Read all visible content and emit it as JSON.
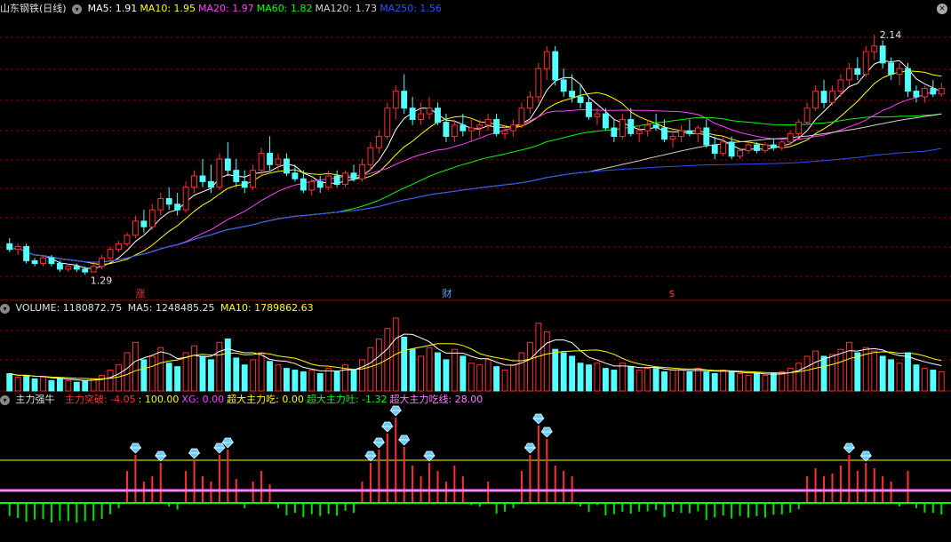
{
  "header": {
    "title": "山东钢铁(日线)",
    "ma": [
      {
        "label": "MA5: 1.91",
        "color": "#ffffff"
      },
      {
        "label": "MA10: 1.95",
        "color": "#ffff00"
      },
      {
        "label": "MA20: 1.97",
        "color": "#ff40ff"
      },
      {
        "label": "MA60: 1.82",
        "color": "#00ff00"
      },
      {
        "label": "MA120: 1.73",
        "color": "#d0d0d0"
      },
      {
        "label": "MA250: 1.56",
        "color": "#3050ff"
      }
    ]
  },
  "price_annotations": {
    "high": "2.14",
    "low": "1.29"
  },
  "event_markers": [
    {
      "text": "涨",
      "color": "#ff3030"
    },
    {
      "text": "财",
      "color": "#60a0ff"
    },
    {
      "text": "$",
      "color": "#ff3030"
    }
  ],
  "volume_header": {
    "title": "VOLUME: 1180872.75",
    "ma5": "MA5: 1248485.25",
    "ma10": "MA10: 1789862.63"
  },
  "indicator_header": {
    "title": "主力强牛",
    "items": [
      {
        "label": "主力突破: -4.05",
        "color": "#ff3030"
      },
      {
        "label": ": 100.00",
        "color": "#ffff00"
      },
      {
        "label": "XG: 0.00",
        "color": "#ff40ff"
      },
      {
        "label": "超大主力吃: 0.00",
        "color": "#ffff00"
      },
      {
        "label": "超大主力吐: -1.32",
        "color": "#00ff00"
      },
      {
        "label": "超大主力吃线: 28.00",
        "color": "#ff80ff"
      }
    ]
  },
  "colors": {
    "up": "#ff3030",
    "down": "#54ffff",
    "grid": "#8b0000",
    "ma5": "#ffffff",
    "ma10": "#ffff00",
    "ma20": "#ff40ff",
    "ma60": "#00ff00",
    "ma120": "#d0d0d0",
    "ma250": "#3050ff"
  },
  "chart_data": {
    "type": "candlestick",
    "price_range": [
      1.25,
      2.2
    ],
    "high_label": 2.14,
    "low_label": 1.29,
    "candles_ohlc": [
      [
        1.4,
        1.42,
        1.37,
        1.38
      ],
      [
        1.38,
        1.4,
        1.36,
        1.39
      ],
      [
        1.39,
        1.4,
        1.33,
        1.34
      ],
      [
        1.34,
        1.35,
        1.32,
        1.33
      ],
      [
        1.33,
        1.36,
        1.32,
        1.35
      ],
      [
        1.35,
        1.36,
        1.32,
        1.33
      ],
      [
        1.33,
        1.34,
        1.3,
        1.31
      ],
      [
        1.31,
        1.33,
        1.3,
        1.32
      ],
      [
        1.32,
        1.33,
        1.3,
        1.31
      ],
      [
        1.31,
        1.32,
        1.29,
        1.3
      ],
      [
        1.3,
        1.33,
        1.3,
        1.32
      ],
      [
        1.32,
        1.36,
        1.31,
        1.35
      ],
      [
        1.35,
        1.39,
        1.34,
        1.38
      ],
      [
        1.38,
        1.41,
        1.37,
        1.4
      ],
      [
        1.4,
        1.44,
        1.39,
        1.43
      ],
      [
        1.43,
        1.5,
        1.42,
        1.48
      ],
      [
        1.48,
        1.52,
        1.44,
        1.46
      ],
      [
        1.46,
        1.54,
        1.45,
        1.52
      ],
      [
        1.52,
        1.58,
        1.5,
        1.56
      ],
      [
        1.56,
        1.6,
        1.52,
        1.54
      ],
      [
        1.54,
        1.58,
        1.5,
        1.52
      ],
      [
        1.52,
        1.62,
        1.51,
        1.6
      ],
      [
        1.6,
        1.66,
        1.58,
        1.64
      ],
      [
        1.64,
        1.7,
        1.6,
        1.62
      ],
      [
        1.62,
        1.68,
        1.58,
        1.6
      ],
      [
        1.6,
        1.72,
        1.59,
        1.7
      ],
      [
        1.7,
        1.76,
        1.64,
        1.66
      ],
      [
        1.66,
        1.7,
        1.6,
        1.62
      ],
      [
        1.62,
        1.66,
        1.58,
        1.6
      ],
      [
        1.6,
        1.68,
        1.59,
        1.66
      ],
      [
        1.66,
        1.74,
        1.64,
        1.72
      ],
      [
        1.72,
        1.78,
        1.66,
        1.68
      ],
      [
        1.68,
        1.72,
        1.66,
        1.7
      ],
      [
        1.7,
        1.72,
        1.64,
        1.65
      ],
      [
        1.65,
        1.68,
        1.62,
        1.63
      ],
      [
        1.63,
        1.66,
        1.58,
        1.59
      ],
      [
        1.59,
        1.63,
        1.57,
        1.62
      ],
      [
        1.62,
        1.64,
        1.58,
        1.6
      ],
      [
        1.6,
        1.66,
        1.59,
        1.64
      ],
      [
        1.64,
        1.66,
        1.6,
        1.61
      ],
      [
        1.61,
        1.66,
        1.6,
        1.65
      ],
      [
        1.65,
        1.68,
        1.62,
        1.63
      ],
      [
        1.63,
        1.7,
        1.62,
        1.68
      ],
      [
        1.68,
        1.76,
        1.66,
        1.74
      ],
      [
        1.74,
        1.8,
        1.72,
        1.78
      ],
      [
        1.78,
        1.9,
        1.77,
        1.88
      ],
      [
        1.88,
        1.96,
        1.84,
        1.94
      ],
      [
        1.94,
        2.0,
        1.86,
        1.88
      ],
      [
        1.88,
        1.92,
        1.82,
        1.84
      ],
      [
        1.84,
        1.9,
        1.82,
        1.86
      ],
      [
        1.86,
        1.92,
        1.84,
        1.88
      ],
      [
        1.88,
        1.9,
        1.82,
        1.83
      ],
      [
        1.83,
        1.86,
        1.76,
        1.78
      ],
      [
        1.78,
        1.84,
        1.76,
        1.82
      ],
      [
        1.82,
        1.86,
        1.78,
        1.8
      ],
      [
        1.8,
        1.84,
        1.76,
        1.81
      ],
      [
        1.81,
        1.84,
        1.78,
        1.82
      ],
      [
        1.82,
        1.86,
        1.8,
        1.84
      ],
      [
        1.84,
        1.86,
        1.78,
        1.79
      ],
      [
        1.79,
        1.82,
        1.77,
        1.8
      ],
      [
        1.8,
        1.84,
        1.78,
        1.82
      ],
      [
        1.82,
        1.9,
        1.81,
        1.88
      ],
      [
        1.88,
        1.94,
        1.86,
        1.92
      ],
      [
        1.92,
        2.04,
        1.9,
        2.02
      ],
      [
        2.02,
        2.1,
        1.98,
        2.08
      ],
      [
        2.08,
        2.1,
        1.96,
        1.98
      ],
      [
        1.98,
        2.02,
        1.92,
        1.94
      ],
      [
        1.94,
        2.0,
        1.9,
        1.92
      ],
      [
        1.92,
        1.96,
        1.88,
        1.9
      ],
      [
        1.9,
        1.92,
        1.84,
        1.85
      ],
      [
        1.85,
        1.88,
        1.82,
        1.86
      ],
      [
        1.86,
        1.88,
        1.8,
        1.81
      ],
      [
        1.81,
        1.84,
        1.76,
        1.78
      ],
      [
        1.78,
        1.86,
        1.77,
        1.84
      ],
      [
        1.84,
        1.88,
        1.78,
        1.79
      ],
      [
        1.79,
        1.82,
        1.76,
        1.8
      ],
      [
        1.8,
        1.84,
        1.78,
        1.82
      ],
      [
        1.82,
        1.86,
        1.8,
        1.81
      ],
      [
        1.81,
        1.84,
        1.76,
        1.77
      ],
      [
        1.77,
        1.8,
        1.74,
        1.78
      ],
      [
        1.78,
        1.82,
        1.76,
        1.8
      ],
      [
        1.8,
        1.84,
        1.78,
        1.79
      ],
      [
        1.79,
        1.82,
        1.76,
        1.81
      ],
      [
        1.81,
        1.84,
        1.74,
        1.75
      ],
      [
        1.75,
        1.78,
        1.7,
        1.72
      ],
      [
        1.72,
        1.78,
        1.71,
        1.76
      ],
      [
        1.76,
        1.78,
        1.7,
        1.71
      ],
      [
        1.71,
        1.74,
        1.7,
        1.73
      ],
      [
        1.73,
        1.76,
        1.72,
        1.75
      ],
      [
        1.75,
        1.76,
        1.72,
        1.73
      ],
      [
        1.73,
        1.76,
        1.72,
        1.75
      ],
      [
        1.75,
        1.77,
        1.73,
        1.74
      ],
      [
        1.74,
        1.77,
        1.73,
        1.76
      ],
      [
        1.76,
        1.8,
        1.75,
        1.79
      ],
      [
        1.79,
        1.84,
        1.78,
        1.83
      ],
      [
        1.83,
        1.9,
        1.82,
        1.88
      ],
      [
        1.88,
        1.96,
        1.87,
        1.94
      ],
      [
        1.94,
        1.98,
        1.88,
        1.9
      ],
      [
        1.9,
        1.96,
        1.89,
        1.94
      ],
      [
        1.94,
        2.0,
        1.92,
        1.98
      ],
      [
        1.98,
        2.04,
        1.96,
        2.02
      ],
      [
        2.02,
        2.06,
        1.98,
        2.0
      ],
      [
        2.0,
        2.1,
        1.99,
        2.08
      ],
      [
        2.08,
        2.14,
        2.05,
        2.1
      ],
      [
        2.1,
        2.12,
        2.02,
        2.04
      ],
      [
        2.04,
        2.06,
        1.98,
        2.0
      ],
      [
        2.0,
        2.04,
        1.96,
        2.02
      ],
      [
        2.02,
        2.04,
        1.92,
        1.94
      ],
      [
        1.94,
        1.96,
        1.9,
        1.92
      ],
      [
        1.92,
        1.96,
        1.9,
        1.95
      ],
      [
        1.95,
        1.98,
        1.92,
        1.93
      ],
      [
        1.93,
        1.97,
        1.92,
        1.95
      ]
    ],
    "volume_values": [
      1.0,
      0.8,
      0.9,
      0.7,
      0.8,
      0.6,
      0.7,
      0.6,
      0.5,
      0.6,
      0.7,
      0.9,
      1.2,
      1.5,
      2.2,
      2.8,
      1.8,
      2.0,
      2.5,
      1.6,
      1.4,
      2.2,
      2.6,
      2.0,
      1.8,
      2.8,
      3.0,
      1.9,
      1.5,
      1.8,
      2.2,
      1.7,
      1.5,
      1.3,
      1.2,
      1.1,
      1.2,
      1.0,
      1.3,
      1.1,
      1.5,
      1.2,
      1.8,
      2.5,
      3.0,
      3.6,
      4.2,
      3.1,
      2.4,
      2.0,
      2.5,
      2.2,
      1.8,
      2.4,
      2.0,
      1.6,
      1.5,
      1.8,
      1.4,
      1.2,
      1.5,
      2.2,
      2.8,
      3.9,
      3.4,
      2.4,
      2.2,
      2.0,
      1.6,
      1.5,
      1.6,
      1.3,
      1.2,
      1.6,
      1.4,
      1.2,
      1.3,
      1.3,
      1.1,
      1.2,
      1.2,
      1.1,
      1.3,
      1.1,
      1.0,
      1.2,
      1.1,
      1.0,
      0.9,
      1.0,
      0.9,
      1.0,
      1.1,
      1.3,
      1.6,
      2.0,
      2.3,
      2.0,
      2.1,
      2.4,
      2.8,
      2.2,
      2.5,
      2.3,
      2.0,
      1.8,
      1.6,
      2.2,
      1.5,
      1.3,
      1.2,
      1.1
    ],
    "volume_ma5": 1248485.25,
    "volume_ma10": 1789862.63,
    "indicator_levels": {
      "upper_line": 100.0,
      "zero_line": 0.0,
      "pink_line": 28.0
    }
  }
}
